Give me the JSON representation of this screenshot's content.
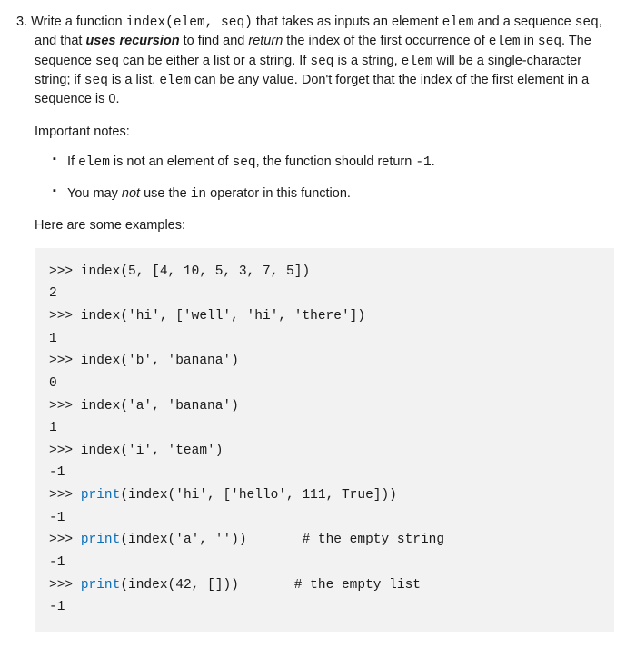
{
  "number": "3.",
  "paragraph_html": "Write a function <span class=\"codeword\">index(elem, seq)</span> that takes as inputs an element <span class=\"codeword\">elem</span> and a sequence <span class=\"codeword\">seq</span>, and that <em><strong>uses recursion</strong></em> to find and <em>return</em> the index of the first occurrence of <span class=\"codeword\">elem</span> in <span class=\"codeword\">seq</span>. The sequence <span class=\"codeword\">seq</span> can be either a list or a string. If <span class=\"codeword\">seq</span> is a string, <span class=\"codeword\">elem</span> will be a single-character string; if <span class=\"codeword\">seq</span> is a list, <span class=\"codeword\">elem</span> can be any value. Don't forget that the index of the first element in a sequence is 0.",
  "notes_heading": "Important notes:",
  "notes": [
    "If <span class=\"codeword\">elem</span> is not an element of <span class=\"codeword\">seq</span>, the function should return <span class=\"codeword\">-1</span>.",
    "You may <em>not</em> use the <span class=\"codeword\">in</span> operator in this function."
  ],
  "examples_heading": "Here are some examples:",
  "code_html": ">>> index(5, [4, 10, 5, 3, 7, 5])\n2\n>>> index('hi', ['well', 'hi', 'there'])\n1\n>>> index('b', 'banana')\n0\n>>> index('a', 'banana')\n1\n>>> index('i', 'team')\n-1\n>>> <span class=\"blue\">print</span>(index('hi', ['hello', 111, True]))\n-1\n>>> <span class=\"blue\">print</span>(index('a', ''))       # the empty string\n-1\n>>> <span class=\"blue\">print</span>(index(42, []))       # the empty list\n-1"
}
